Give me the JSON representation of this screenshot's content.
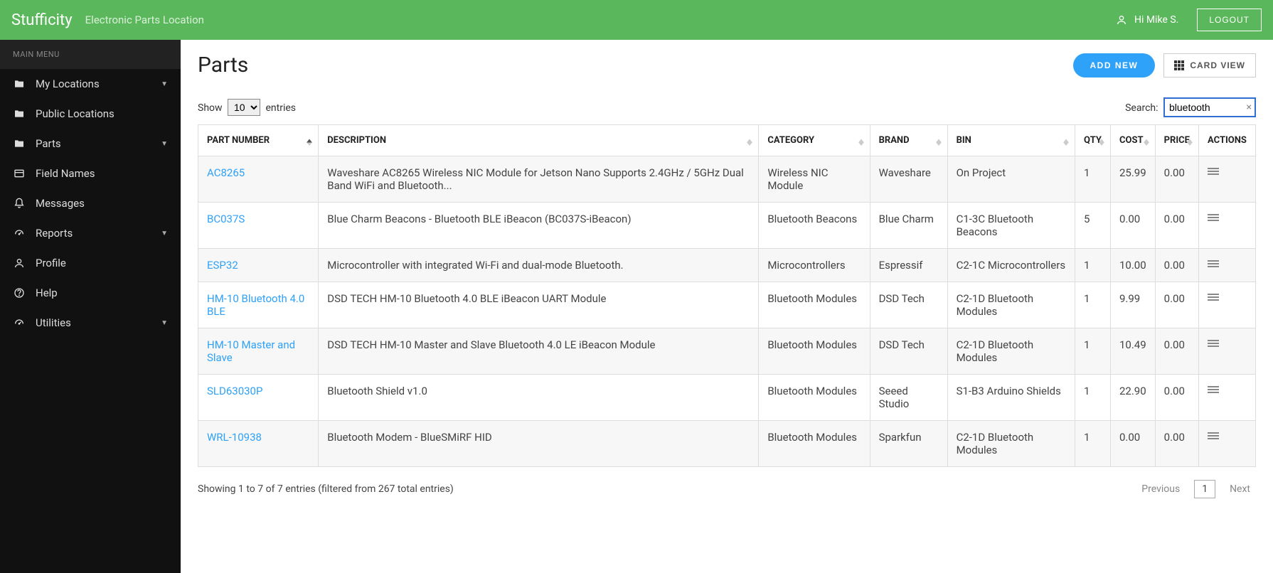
{
  "header": {
    "brand": "Stufficity",
    "tagline": "Electronic Parts Location",
    "greeting": "Hi Mike S.",
    "logout": "LOGOUT"
  },
  "sidebar": {
    "menu_header": "MAIN MENU",
    "items": [
      {
        "label": "My Locations",
        "icon": "folder",
        "expandable": true
      },
      {
        "label": "Public Locations",
        "icon": "folder",
        "expandable": false
      },
      {
        "label": "Parts",
        "icon": "folder",
        "expandable": true
      },
      {
        "label": "Field Names",
        "icon": "card",
        "expandable": false
      },
      {
        "label": "Messages",
        "icon": "bell",
        "expandable": false
      },
      {
        "label": "Reports",
        "icon": "gauge",
        "expandable": true
      },
      {
        "label": "Profile",
        "icon": "user",
        "expandable": false
      },
      {
        "label": "Help",
        "icon": "help",
        "expandable": false
      },
      {
        "label": "Utilities",
        "icon": "gauge",
        "expandable": true
      }
    ]
  },
  "page": {
    "title": "Parts",
    "add_new": "ADD NEW",
    "card_view": "CARD VIEW"
  },
  "table_controls": {
    "show_label": "Show",
    "entries_label": "entries",
    "page_size": "10",
    "search_label": "Search:",
    "search_value": "bluetooth"
  },
  "table": {
    "columns": [
      "PART NUMBER",
      "DESCRIPTION",
      "CATEGORY",
      "BRAND",
      "BIN",
      "QTY",
      "COST",
      "PRICE",
      "ACTIONS"
    ],
    "rows": [
      {
        "part": "AC8265",
        "desc": "Waveshare AC8265 Wireless NIC Module for Jetson Nano Supports 2.4GHz / 5GHz Dual Band WiFi and Bluetooth...",
        "category": "Wireless NIC Module",
        "brand": "Waveshare",
        "bin": "On Project",
        "qty": "1",
        "cost": "25.99",
        "price": "0.00"
      },
      {
        "part": "BC037S",
        "desc": "Blue Charm Beacons - Bluetooth BLE iBeacon (BC037S-iBeacon)",
        "category": "Bluetooth Beacons",
        "brand": "Blue Charm",
        "bin": "C1-3C Bluetooth Beacons",
        "qty": "5",
        "cost": "0.00",
        "price": "0.00"
      },
      {
        "part": "ESP32",
        "desc": "Microcontroller with integrated Wi-Fi and dual-mode Bluetooth.",
        "category": "Microcontrollers",
        "brand": "Espressif",
        "bin": "C2-1C Microcontrollers",
        "qty": "1",
        "cost": "10.00",
        "price": "0.00"
      },
      {
        "part": "HM-10 Bluetooth 4.0 BLE",
        "desc": "DSD TECH HM-10 Bluetooth 4.0 BLE iBeacon UART Module",
        "category": "Bluetooth Modules",
        "brand": "DSD Tech",
        "bin": "C2-1D Bluetooth Modules",
        "qty": "1",
        "cost": "9.99",
        "price": "0.00"
      },
      {
        "part": "HM-10 Master and Slave",
        "desc": "DSD TECH HM-10 Master and Slave Bluetooth 4.0 LE iBeacon Module",
        "category": "Bluetooth Modules",
        "brand": "DSD Tech",
        "bin": "C2-1D Bluetooth Modules",
        "qty": "1",
        "cost": "10.49",
        "price": "0.00"
      },
      {
        "part": "SLD63030P",
        "desc": "Bluetooth Shield v1.0",
        "category": "Bluetooth Modules",
        "brand": "Seeed Studio",
        "bin": "S1-B3 Arduino Shields",
        "qty": "1",
        "cost": "22.90",
        "price": "0.00"
      },
      {
        "part": "WRL-10938",
        "desc": "Bluetooth Modem - BlueSMiRF HID",
        "category": "Bluetooth Modules",
        "brand": "Sparkfun",
        "bin": "C2-1D Bluetooth Modules",
        "qty": "1",
        "cost": "0.00",
        "price": "0.00"
      }
    ]
  },
  "footer": {
    "info": "Showing 1 to 7 of 7 entries (filtered from 267 total entries)",
    "prev": "Previous",
    "page": "1",
    "next": "Next"
  }
}
